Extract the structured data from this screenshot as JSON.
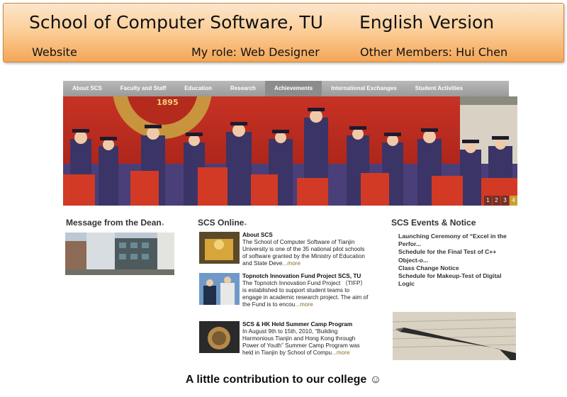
{
  "banner": {
    "title": "School of Computer Software, TU",
    "version": "English Version",
    "website": "Website",
    "role": "My role: Web Designer",
    "members": "Other Members: Hui Chen"
  },
  "nav": [
    "About SCS",
    "Faculty and Staff",
    "Education",
    "Research",
    "Achievements",
    "International Exchanges",
    "Student Activities"
  ],
  "hero": {
    "pages": [
      "1",
      "2",
      "3",
      "4"
    ],
    "active_page": "4",
    "sign_text": "1895"
  },
  "dean": {
    "title": "Message from the Dean"
  },
  "online": {
    "title": "SCS Online",
    "items": [
      {
        "title": "About SCS",
        "body": "The School of Computer Software of Tianjin University is one of the 35 national pilot schools of software granted by the Ministry of Education and State Deve",
        "more": "...more"
      },
      {
        "title": "Topnotch Innovation Fund Project SCS, TU",
        "body": " The Topnotch Innovation Fund Project （TIFP） is established to support student teams to engage in academic research project. The aim of the Fund is to encou",
        "more": "...more"
      },
      {
        "title": "SCS & HK Held Summer Camp Program",
        "body": " In August 9th to 15th, 2010, “Building Harmonious Tianjin and Hong Kong through Power of Youth” Summer Camp Program was held in Tianjin by School of Compu",
        "more": "...more"
      }
    ]
  },
  "events": {
    "title": "SCS Events & Notice",
    "items": [
      "Launching Ceremony of “Excel in the Perfor...",
      "Schedule for the Final Test of C++ Object-o...",
      "Class Change Notice",
      "Schedule for Makeup-Test of Digital Logic"
    ]
  },
  "caption": "A little contribution to our college ☺",
  "colors": {
    "nav": "#a6a6a6",
    "banner": "#f8b878",
    "hero_red": "#b92a20"
  }
}
